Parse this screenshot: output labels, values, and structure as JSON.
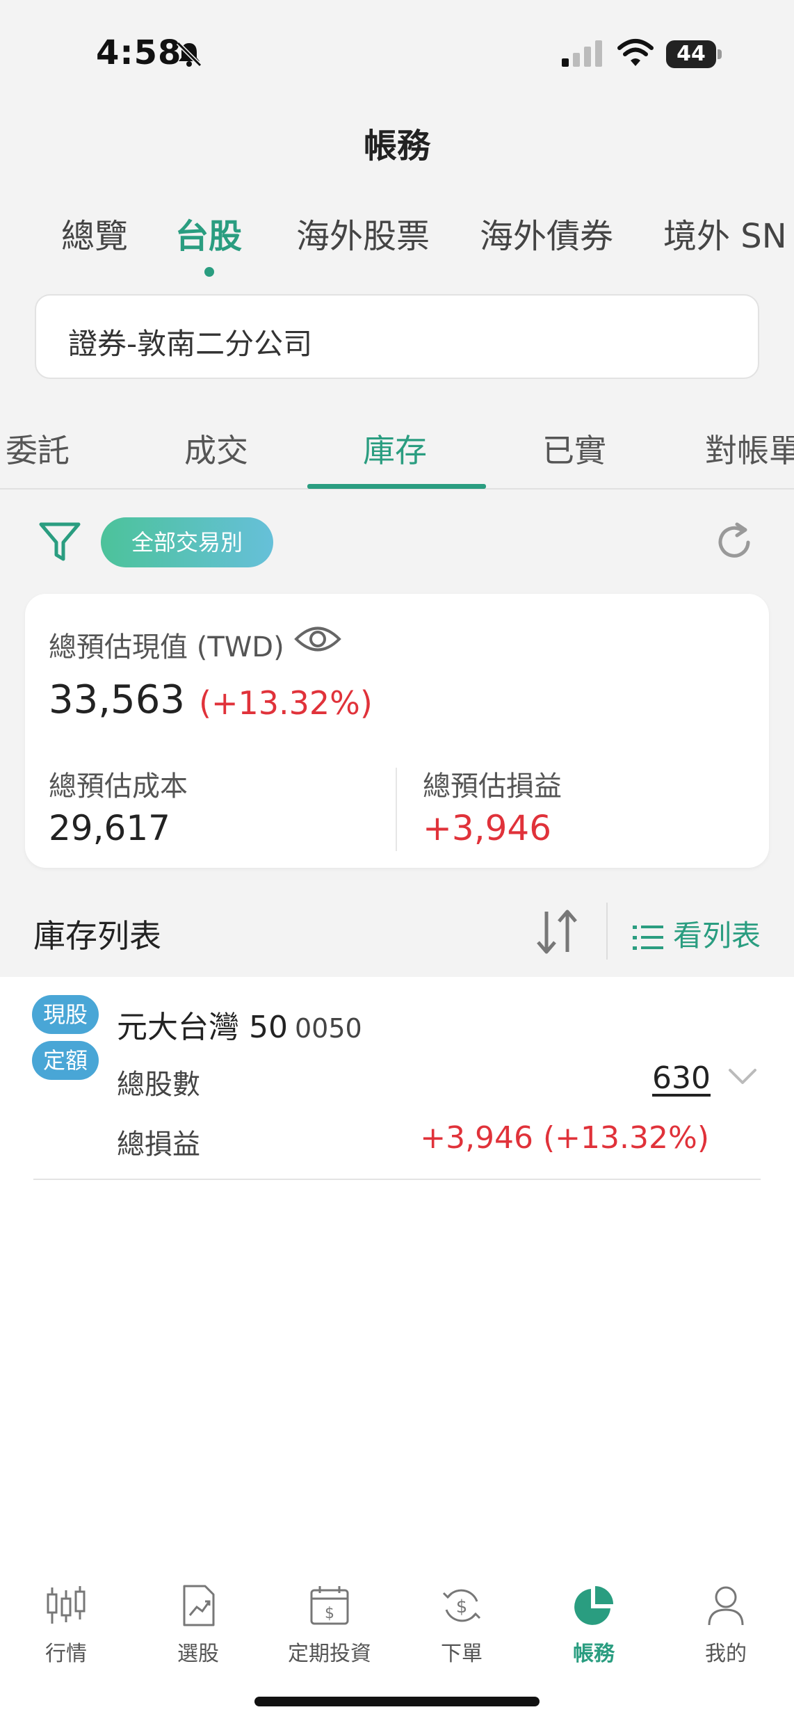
{
  "status": {
    "time": "4:58",
    "battery": "44"
  },
  "title": "帳務",
  "market_tabs": [
    {
      "label": "總覽"
    },
    {
      "label": "台股"
    },
    {
      "label": "海外股票"
    },
    {
      "label": "海外債券"
    },
    {
      "label": "境外 SN"
    }
  ],
  "account": {
    "value": "證券-敦南二分公司"
  },
  "sub_tabs": [
    {
      "label": "委託"
    },
    {
      "label": "成交"
    },
    {
      "label": "庫存"
    },
    {
      "label": "已實"
    },
    {
      "label": "對帳單"
    }
  ],
  "filter": {
    "chip_label": "全部交易別"
  },
  "summary": {
    "total_value_label": "總預估現值 (TWD)",
    "total_value": "33,563",
    "total_value_pct": "(+13.32%)",
    "cost_label": "總預估成本",
    "cost_value": "29,617",
    "pl_label": "總預估損益",
    "pl_value": "+3,946"
  },
  "holdings_header": {
    "title": "庫存列表",
    "view_list_label": "看列表"
  },
  "holdings": [
    {
      "badge1": "現股",
      "badge2": "定額",
      "name": "元大台灣 50",
      "code": "0050",
      "shares_label": "總股數",
      "shares": "630",
      "pl_label": "總損益",
      "pl": "+3,946 (+13.32%)"
    }
  ],
  "bottom_nav": [
    {
      "label": "行情",
      "icon": "candlestick-icon"
    },
    {
      "label": "選股",
      "icon": "chart-document-icon"
    },
    {
      "label": "定期投資",
      "icon": "calendar-dollar-icon"
    },
    {
      "label": "下單",
      "icon": "dollar-cycle-icon"
    },
    {
      "label": "帳務",
      "icon": "pie-chart-icon"
    },
    {
      "label": "我的",
      "icon": "person-icon"
    }
  ],
  "colors": {
    "accent": "#2a9d80",
    "positive": "#e0323a",
    "badge": "#49a6d6"
  }
}
